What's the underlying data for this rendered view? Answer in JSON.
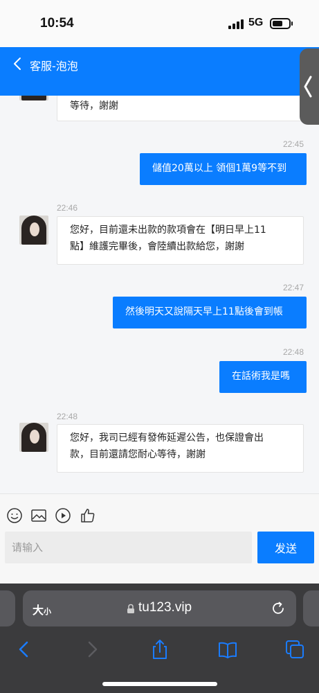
{
  "status_bar": {
    "time": "10:54",
    "network": "5G"
  },
  "header": {
    "title": "客服-泡泡"
  },
  "messages": [
    {
      "id": "m0",
      "direction": "incoming",
      "text": "等待，謝謝"
    },
    {
      "id": "m1",
      "direction": "outgoing",
      "time": "22:45",
      "text": "儲值20萬以上 領個1萬9等不到"
    },
    {
      "id": "m2",
      "direction": "incoming",
      "time": "22:46",
      "lines": [
        "您好，目前還未出款的款項會在【明日早上11",
        "點】維護完畢後，會陸續出款給您，謝謝"
      ]
    },
    {
      "id": "m3",
      "direction": "outgoing",
      "time": "22:47",
      "text": "然後明天又說隔天早上11點後會到帳"
    },
    {
      "id": "m4",
      "direction": "outgoing",
      "time": "22:48",
      "text": "在話術我是嗎"
    },
    {
      "id": "m5",
      "direction": "incoming",
      "time": "22:48",
      "lines": [
        "您好，我司已經有發佈延遲公告，也保證會出",
        "款，目前還請您耐心等待，謝謝"
      ]
    }
  ],
  "composer": {
    "placeholder": "请输入",
    "value": "",
    "send_label": "发送"
  },
  "browser": {
    "text_size_label": "大",
    "text_size_small": "小",
    "url": "tu123.vip"
  },
  "colors": {
    "accent": "#0a7dff",
    "bubble_in": "#ffffff",
    "chat_bg": "#f5f6f8",
    "browser_bg": "#3b3b3d"
  }
}
